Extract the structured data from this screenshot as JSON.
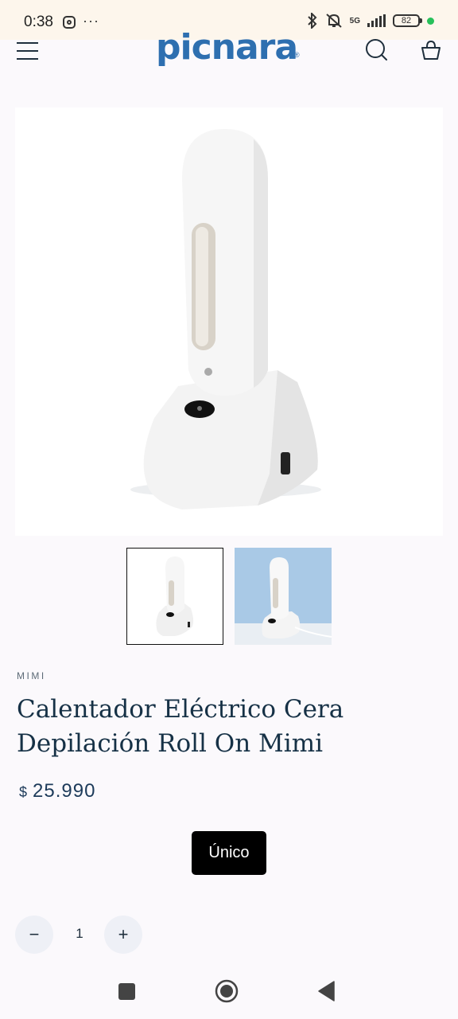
{
  "status_bar": {
    "time": "0:38",
    "more": "···",
    "network": "5G",
    "battery": "82"
  },
  "header": {
    "logo": "picnara",
    "logo_mark": "®"
  },
  "gallery": {
    "selected_index": 0,
    "thumbnail_count": 2
  },
  "product": {
    "brand": "MIMI",
    "title": "Calentador Eléctrico Cera Depilación Roll On Mimi",
    "currency": "$",
    "price": "25.990",
    "variant_label": "Único",
    "quantity": "1",
    "minus_label": "−",
    "plus_label": "+"
  },
  "colors": {
    "background": "#fbf9fc",
    "text": "#1f2f3d",
    "logo": "#2e6fb0",
    "button": "#000000"
  }
}
